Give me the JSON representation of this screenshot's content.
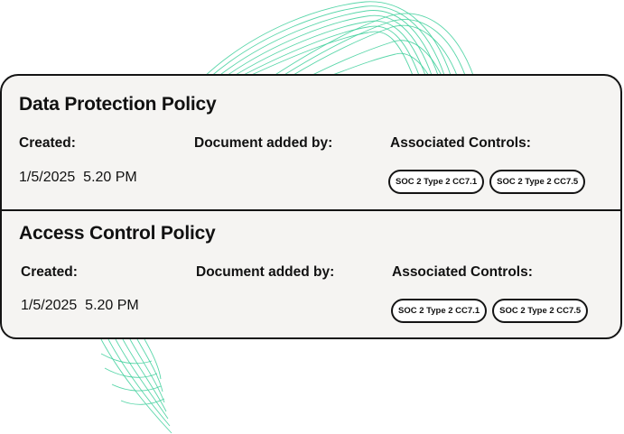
{
  "colors": {
    "accent_mesh": "#3ccf9a",
    "card_background": "#f5f4f2",
    "border": "#141414"
  },
  "policies": [
    {
      "title": "Data Protection Policy",
      "created_label": "Created:",
      "added_by_label": "Document added by:",
      "controls_label": "Associated Controls:",
      "created_value": "1/5/2025  5.20 PM",
      "added_by_value": "",
      "controls": [
        "SOC 2 Type 2 CC7.1",
        "SOC 2 Type 2 CC7.5"
      ]
    },
    {
      "title": "Access Control Policy",
      "created_label": "Created:",
      "added_by_label": "Document added by:",
      "controls_label": "Associated Controls:",
      "created_value": "1/5/2025  5.20 PM",
      "added_by_value": "",
      "controls": [
        "SOC 2 Type 2 CC7.1",
        "SOC 2 Type 2 CC7.5"
      ]
    }
  ]
}
